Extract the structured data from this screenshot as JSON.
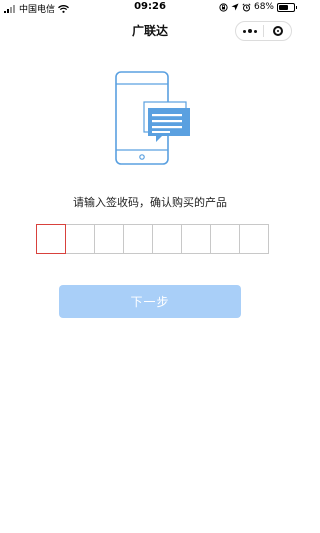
{
  "status_bar": {
    "carrier": "中国电信",
    "time": "09:26",
    "battery_percent": "68%",
    "battery_level": 0.68
  },
  "nav": {
    "title": "广联达",
    "more_icon": "more-dots-icon",
    "close_icon": "target-ring-icon"
  },
  "main": {
    "prompt": "请输入签收码，确认购买的产品",
    "code_box_count": 8,
    "next_button_label": "下一步"
  },
  "colors": {
    "accent_blue": "#5aa0e0",
    "button_disabled": "#a9cff8",
    "active_box_border": "#d8413c"
  }
}
